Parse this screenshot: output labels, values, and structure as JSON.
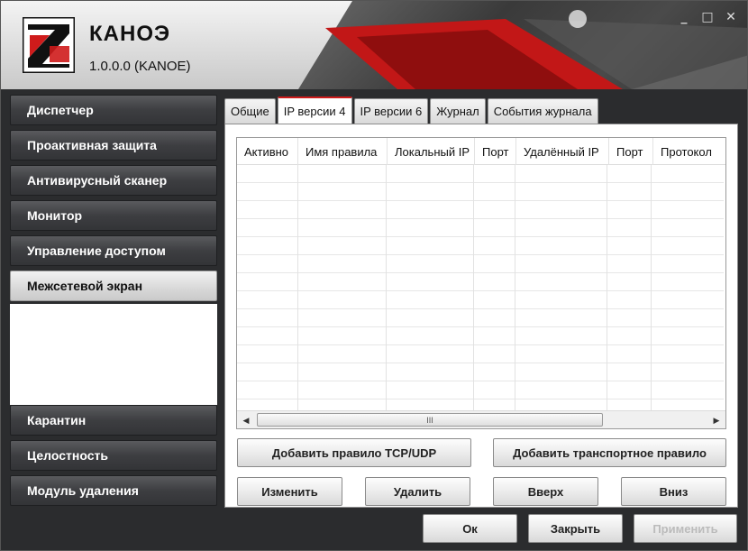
{
  "app": {
    "title": "КАНОЭ",
    "version": "1.0.0.0  (KANOE)"
  },
  "window_controls": {
    "minimize": "_",
    "maximize": "□",
    "close": "✕"
  },
  "sidebar": {
    "items": [
      {
        "label": "Диспетчер"
      },
      {
        "label": "Проактивная защита"
      },
      {
        "label": "Антивирусный сканер"
      },
      {
        "label": "Монитор"
      },
      {
        "label": "Управление доступом"
      },
      {
        "label": "Межсетевой экран"
      },
      {
        "label": "Карантин"
      },
      {
        "label": "Целостность"
      },
      {
        "label": "Модуль удаления"
      }
    ],
    "active": "Межсетевой экран"
  },
  "tabs": [
    {
      "label": "Общие"
    },
    {
      "label": "IP версии 4"
    },
    {
      "label": "IP версии 6"
    },
    {
      "label": "Журнал"
    },
    {
      "label": "События журнала"
    }
  ],
  "active_tab": "IP версии 4",
  "table": {
    "columns": [
      "Активно",
      "Имя правила",
      "Локальный IP",
      "Порт",
      "Удалённый IP",
      "Порт",
      "Протокол"
    ],
    "rows": [],
    "scroll_thumb_glyph": "III",
    "scroll_left_glyph": "◀",
    "scroll_right_glyph": "▶"
  },
  "actions": {
    "add_tcp_udp": "Добавить правило TCP/UDP",
    "add_transport": "Добавить транспортное правило",
    "edit": "Изменить",
    "delete": "Удалить",
    "up": "Вверх",
    "down": "Вниз"
  },
  "footer": {
    "ok": "Ок",
    "close": "Закрыть",
    "apply": "Применить"
  },
  "colors": {
    "accent_red": "#cf1b1b",
    "dark_bg": "#2b2c2e"
  }
}
